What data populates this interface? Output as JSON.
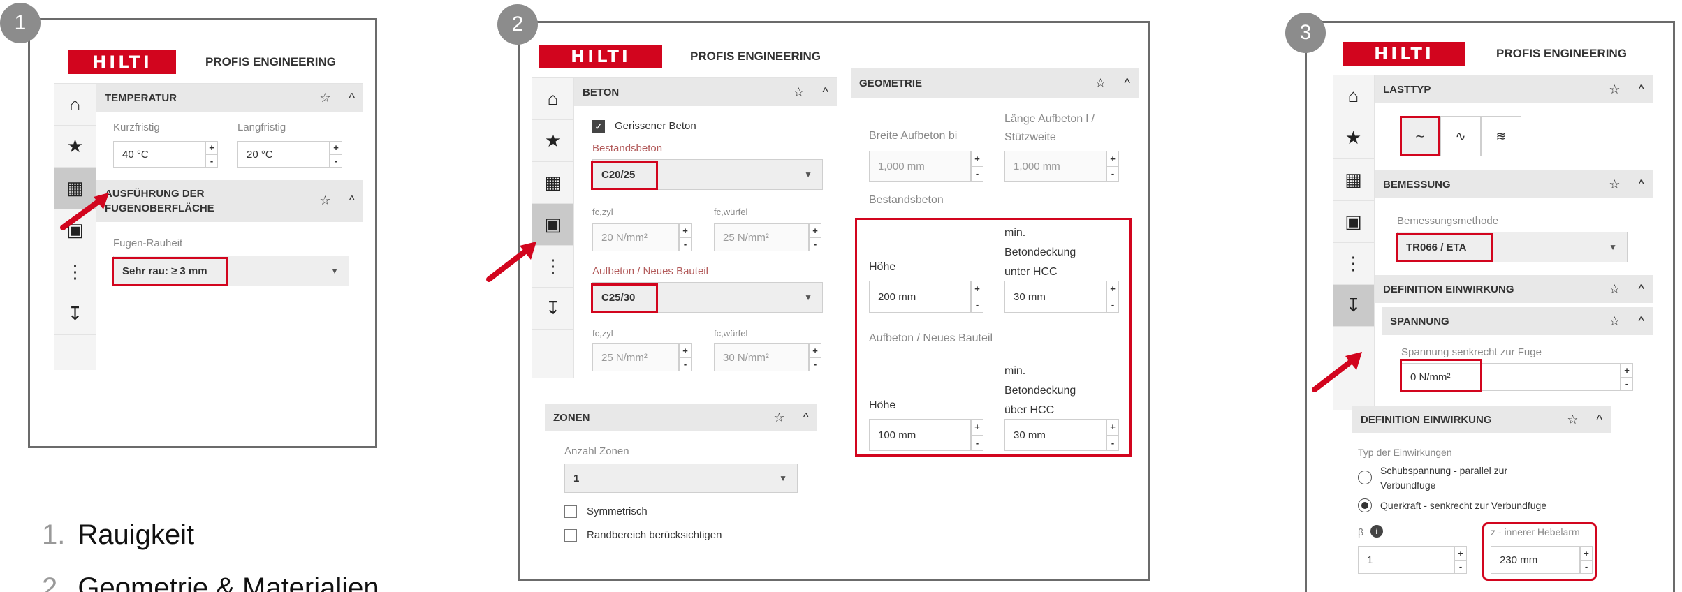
{
  "brand": {
    "logo_text": "HILTI",
    "app_title": "PROFIS ENGINEERING",
    "accent": "#d2051e"
  },
  "badges": [
    "1",
    "2",
    "3"
  ],
  "icons": {
    "star": "☆",
    "chevron_up": "^",
    "caret_down": "▼",
    "plus": "+",
    "minus": "-",
    "check": "✓",
    "info": "i"
  },
  "sidebar_icons": [
    "home-icon",
    "star-icon",
    "concrete-blocks-icon",
    "cube-icon",
    "anchor-icon",
    "load-icon"
  ],
  "panel1": {
    "temp_header": "TEMPERATUR",
    "short_label": "Kurzfristig",
    "long_label": "Langfristig",
    "short_value": "40 °C",
    "long_value": "20 °C",
    "exec_header_line1": "AUSFÜHRUNG DER",
    "exec_header_line2": "FUGENOBERFLÄCHE",
    "roughness_label": "Fugen-Rauheit",
    "roughness_value": "Sehr rau: ≥ 3 mm"
  },
  "panel2": {
    "beton_header": "BETON",
    "cracked_label": "Gerissener Beton",
    "existing_label": "Bestandsbeton",
    "existing_value": "C20/25",
    "fc_zyl": "fc,zyl",
    "fc_wurfel": "fc,würfel",
    "existing_fczyl": "20 N/mm²",
    "existing_fcwurfel": "25 N/mm²",
    "new_label": "Aufbeton / Neues Bauteil",
    "new_value": "C25/30",
    "new_fczyl": "25 N/mm²",
    "new_fcwurfel": "30 N/mm²",
    "zonen_header": "ZONEN",
    "zones_label": "Anzahl Zonen",
    "zones_value": "1",
    "symmetric_label": "Symmetrisch",
    "edge_label": "Randbereich berücksichtigen",
    "geo_header": "GEOMETRIE",
    "width_label": "Breite Aufbeton bi",
    "length_label_1": "Länge Aufbeton l /",
    "length_label_2": "Stützweite",
    "width_value": "1,000 mm",
    "length_value": "1,000 mm",
    "geo_existing_label": "Bestandsbeton",
    "height_label": "Höhe",
    "cover_under_1": "min.",
    "cover_under_2": "Betondeckung",
    "cover_under_3": "unter HCC",
    "existing_height": "200 mm",
    "existing_cover": "30 mm",
    "geo_new_label": "Aufbeton / Neues Bauteil",
    "cover_over_1": "min.",
    "cover_over_2": "Betondeckung",
    "cover_over_3": "über HCC",
    "new_height": "100 mm",
    "new_cover": "30 mm"
  },
  "panel3": {
    "loadtype_header": "LASTTYP",
    "bemessung_header": "BEMESSUNG",
    "method_label": "Bemessungsmethode",
    "method_value": "TR066 / ETA",
    "def_header": "DEFINITION EINWIRKUNG",
    "spannung_header": "SPANNUNG",
    "stress_label": "Spannung senkrecht zur Fuge",
    "stress_value": "0 N/mm²",
    "def_header_2": "DEFINITION EINWIRKUNG",
    "types_label": "Typ der Einwirkungen",
    "option1_line1": "Schubspannung - parallel zur",
    "option1_line2": "Verbundfuge",
    "option2": "Querkraft - senkrecht zur Verbundfuge",
    "beta_label": "β",
    "beta_value": "1",
    "z_label": "z - innerer Hebelarm",
    "z_value": "230 mm"
  },
  "legend": [
    {
      "index": "1.",
      "text": "Rauigkeit"
    },
    {
      "index": "2.",
      "text": "Geometrie & Materialien"
    }
  ]
}
